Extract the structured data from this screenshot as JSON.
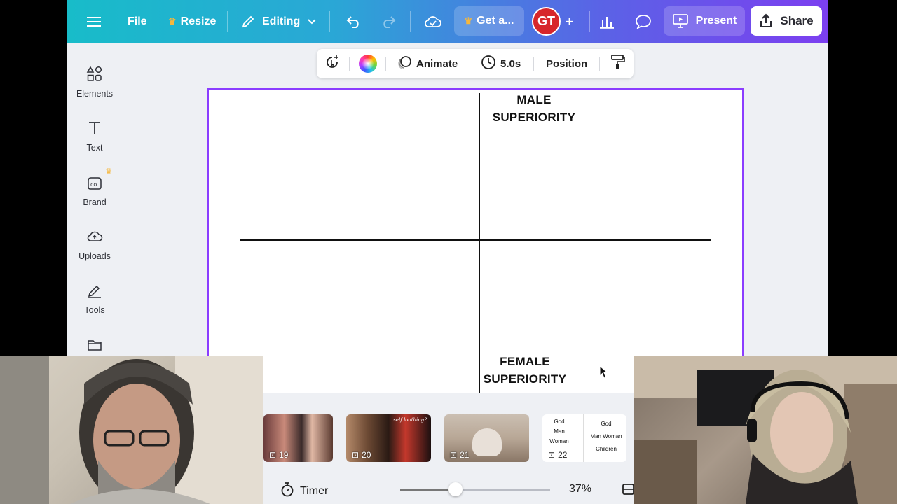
{
  "topbar": {
    "file": "File",
    "resize": "Resize",
    "editing": "Editing",
    "get_pro": "Get a...",
    "avatar_initials": "GT",
    "present": "Present",
    "share": "Share"
  },
  "context_toolbar": {
    "animate": "Animate",
    "duration": "5.0s",
    "position": "Position"
  },
  "sidebar": {
    "items": [
      {
        "label": "Elements",
        "icon": "elements-icon"
      },
      {
        "label": "Text",
        "icon": "text-icon"
      },
      {
        "label": "Brand",
        "icon": "brand-icon"
      },
      {
        "label": "Uploads",
        "icon": "uploads-icon"
      },
      {
        "label": "Tools",
        "icon": "tools-icon"
      }
    ]
  },
  "canvas": {
    "top_label_line1": "MALE",
    "top_label_line2": "SUPERIORITY",
    "bottom_label_line1": "FEMALE",
    "bottom_label_line2": "SUPERIORITY"
  },
  "pages": {
    "thumbs": [
      {
        "number": "19"
      },
      {
        "number": "20"
      },
      {
        "number": "21"
      },
      {
        "number": "22"
      }
    ],
    "thumb22": {
      "left_lines": [
        "God",
        "Man",
        "Woman"
      ],
      "right_lines": [
        "God",
        "Man  Woman",
        "Children"
      ]
    },
    "thumb20_caption": "self loathing?"
  },
  "footer": {
    "timer": "Timer",
    "zoom": "37%",
    "zoom_fraction": 0.37
  },
  "colors": {
    "selection": "#8b3dff",
    "avatar": "#d7262b",
    "topbar_start": "#18bcc9",
    "topbar_end": "#7c3ff0"
  }
}
